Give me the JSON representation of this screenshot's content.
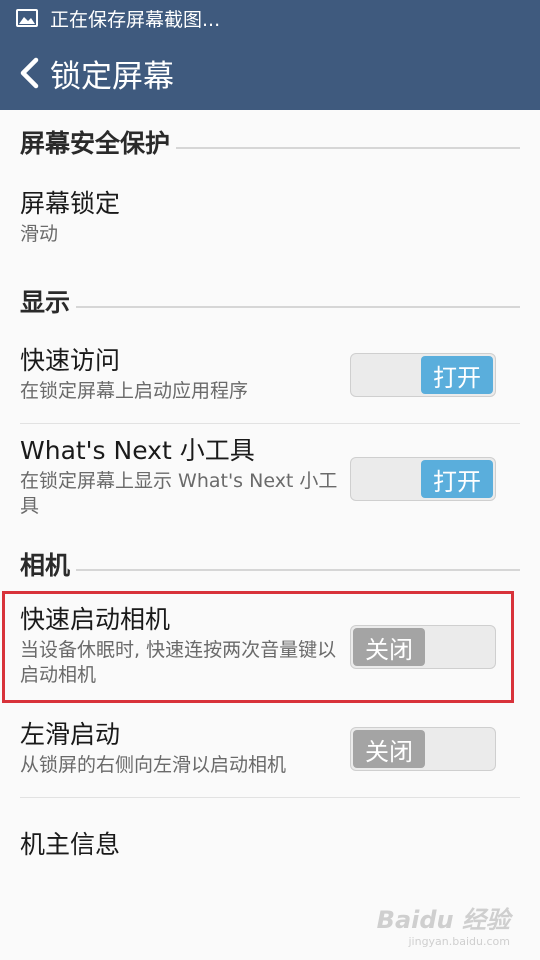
{
  "status_bar": {
    "text": "正在保存屏幕截图..."
  },
  "app_bar": {
    "title": "锁定屏幕"
  },
  "sections": {
    "security": "屏幕安全保护",
    "display": "显示",
    "camera": "相机"
  },
  "items": {
    "screen_lock": {
      "title": "屏幕锁定",
      "subtitle": "滑动"
    },
    "quick_access": {
      "title": "快速访问",
      "subtitle": "在锁定屏幕上启动应用程序",
      "toggle": "打开"
    },
    "whats_next": {
      "title": "What's Next 小工具",
      "subtitle": "在锁定屏幕上显示 What's Next 小工具",
      "toggle": "打开"
    },
    "quick_camera": {
      "title": "快速启动相机",
      "subtitle": "当设备休眠时, 快速连按两次音量键以启动相机",
      "toggle": "关闭"
    },
    "swipe_left": {
      "title": "左滑启动",
      "subtitle": "从锁屏的右侧向左滑以启动相机",
      "toggle": "关闭"
    },
    "owner_info": {
      "title": "机主信息"
    }
  },
  "watermark": {
    "brand": "Baidu 经验",
    "url": "jingyan.baidu.com"
  },
  "colors": {
    "app_bar": "#3f5a7e",
    "toggle_on": "#5aaedc",
    "toggle_off": "#a4a4a4",
    "highlight": "#d8323a"
  }
}
